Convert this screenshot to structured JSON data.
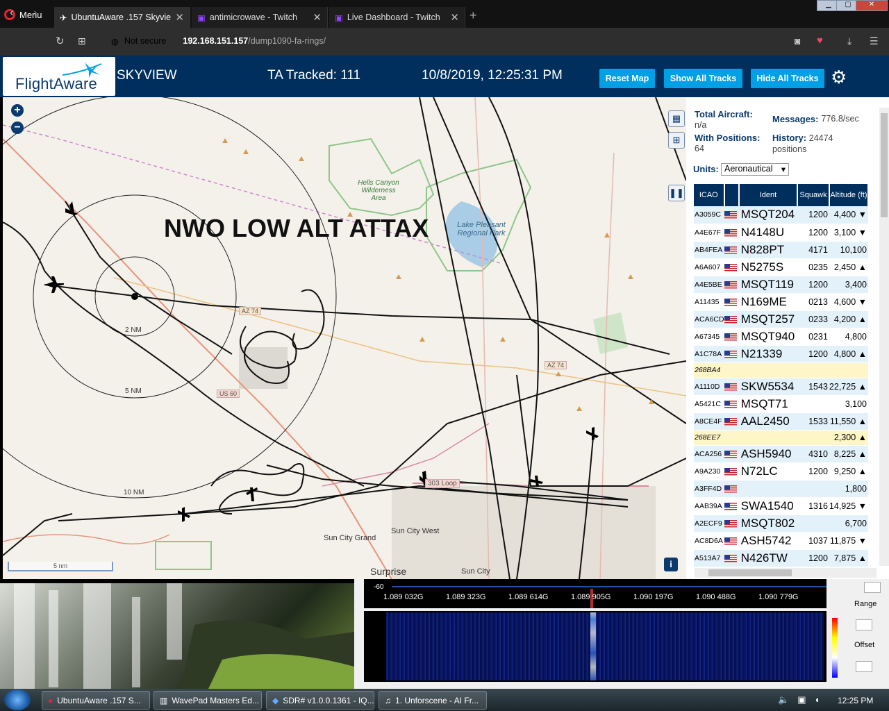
{
  "browser": {
    "menu_label": "Menu",
    "tabs": [
      {
        "title": "UbuntuAware .157 Skyview",
        "active": true
      },
      {
        "title": "antimicrowave - Twitch",
        "active": false
      },
      {
        "title": "Live Dashboard - Twitch",
        "active": false
      }
    ],
    "security_label": "Not secure",
    "url_host": "192.168.151.157",
    "url_path": "/dump1090-fa-rings/"
  },
  "header": {
    "logo": "FlightAware",
    "app_name": "SKYVIEW",
    "tracked": "TA Tracked: 111",
    "datetime": "10/8/2019, 12:25:31 PM",
    "buttons": [
      "Reset Map",
      "Show All Tracks",
      "Hide All Tracks"
    ]
  },
  "map": {
    "overlay_title": "NWO LOW ALT ATTAX",
    "scale_label": "5 nm",
    "ring_labels": [
      "2 NM",
      "5 NM",
      "10 NM"
    ],
    "place_labels": [
      "Hells Canyon Wilderness Area",
      "Lake Pleasant Regional Park",
      "Sun City Grand",
      "Sun City West",
      "Surprise",
      "Sun City"
    ],
    "road_labels": [
      "AZ 74",
      "AZ 74",
      "US 60",
      "303 Loop"
    ],
    "info_icon": "i"
  },
  "panel": {
    "total_aircraft_label": "Total Aircraft:",
    "total_aircraft_value": "n/a",
    "with_positions_label": "With Positions:",
    "with_positions_value": "64",
    "messages_label": "Messages:",
    "messages_value": "776.8/sec",
    "history_label": "History:",
    "history_value": "24474 positions",
    "units_label": "Units:",
    "units_value": "Aeronautical",
    "columns": [
      "ICAO",
      "",
      "Ident",
      "Squawk",
      "Altitude (ft)"
    ],
    "rows": [
      {
        "icao": "A3059C",
        "flag": true,
        "ident": "MSQT204",
        "squawk": "1200",
        "alt": "4,400 ▼"
      },
      {
        "icao": "A4E67F",
        "flag": true,
        "ident": "N4148U",
        "squawk": "1200",
        "alt": "3,100 ▼"
      },
      {
        "icao": "AB4FEA",
        "flag": true,
        "ident": "N828PT",
        "squawk": "4171",
        "alt": "10,100"
      },
      {
        "icao": "A6A607",
        "flag": true,
        "ident": "N5275S",
        "squawk": "0235",
        "alt": "2,450 ▲"
      },
      {
        "icao": "A4E5BE",
        "flag": true,
        "ident": "MSQT119",
        "squawk": "1200",
        "alt": "3,400"
      },
      {
        "icao": "A11435",
        "flag": true,
        "ident": "N169ME",
        "squawk": "0213",
        "alt": "4,600 ▼"
      },
      {
        "icao": "ACA6CD",
        "flag": true,
        "ident": "MSQT257",
        "squawk": "0233",
        "alt": "4,200 ▲"
      },
      {
        "icao": "A67345",
        "flag": true,
        "ident": "MSQT940",
        "squawk": "0231",
        "alt": "4,800"
      },
      {
        "icao": "A1C78A",
        "flag": true,
        "ident": "N21339",
        "squawk": "1200",
        "alt": "4,800 ▲"
      },
      {
        "icao": "268BA4",
        "flag": false,
        "ident": "",
        "squawk": "",
        "alt": "",
        "highlight": true
      },
      {
        "icao": "A1110D",
        "flag": true,
        "ident": "SKW5534",
        "squawk": "1543",
        "alt": "22,725 ▲"
      },
      {
        "icao": "A5421C",
        "flag": true,
        "ident": "MSQT71",
        "squawk": "",
        "alt": "3,100"
      },
      {
        "icao": "A8CE4F",
        "flag": true,
        "ident": "AAL2450",
        "squawk": "1533",
        "alt": "11,550 ▲"
      },
      {
        "icao": "268EE7",
        "flag": false,
        "ident": "",
        "squawk": "",
        "alt": "2,300 ▲",
        "highlight": true
      },
      {
        "icao": "ACA256",
        "flag": true,
        "ident": "ASH5940",
        "squawk": "4310",
        "alt": "8,225 ▲"
      },
      {
        "icao": "A9A230",
        "flag": true,
        "ident": "N72LC",
        "squawk": "1200",
        "alt": "9,250 ▲"
      },
      {
        "icao": "A3FF4D",
        "flag": true,
        "ident": "",
        "squawk": "",
        "alt": "1,800"
      },
      {
        "icao": "AAB39A",
        "flag": true,
        "ident": "SWA1540",
        "squawk": "1316",
        "alt": "14,925 ▼"
      },
      {
        "icao": "A2ECF9",
        "flag": true,
        "ident": "MSQT802",
        "squawk": "",
        "alt": "6,700"
      },
      {
        "icao": "AC8D6A",
        "flag": true,
        "ident": "ASH5742",
        "squawk": "1037",
        "alt": "11,875 ▼"
      },
      {
        "icao": "A513A7",
        "flag": true,
        "ident": "N426TW",
        "squawk": "1200",
        "alt": "7,875 ▲"
      }
    ]
  },
  "sdr": {
    "db_label": "-60",
    "freqs": [
      "1.089 032G",
      "1.089 323G",
      "1.089 614G",
      "1.089 905G",
      "1.090 197G",
      "1.090 488G",
      "1.090 779G"
    ],
    "side_labels": [
      "Range",
      "Offset"
    ]
  },
  "taskbar": {
    "items": [
      "UbuntuAware .157 S...",
      "WavePad Masters Ed...",
      "SDR# v1.0.0.1361 - IQ...",
      "1. Unforscene - AI Fr..."
    ],
    "clock": "12:25 PM"
  },
  "colors": {
    "header_bg": "#002f5d",
    "button": "#00a0e6",
    "highlight_row": "#fff6c8",
    "odd_row": "#e3f1fb"
  }
}
